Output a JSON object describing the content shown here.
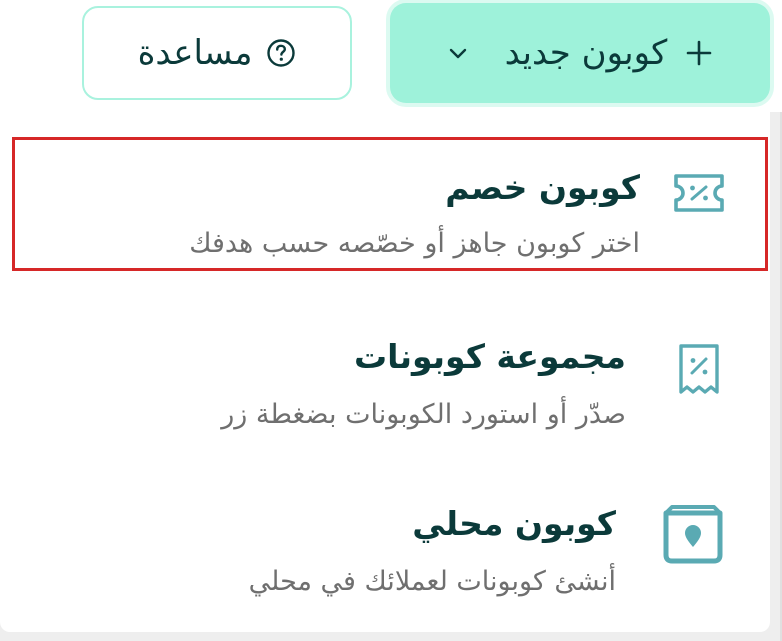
{
  "toolbar": {
    "help_label": "مساعدة",
    "new_coupon_label": "كوبون جديد"
  },
  "menu": {
    "items": [
      {
        "title": "كوبون خصم",
        "description": "اختر كوبون جاهز أو خصّصه حسب هدفك",
        "icon": "ticket-percent-icon"
      },
      {
        "title": "مجموعة كوبونات",
        "description": "صدّر أو استورد الكوبونات بضغطة زر",
        "icon": "receipt-percent-icon"
      },
      {
        "title": "كوبون محلي",
        "description": "أنشئ كوبونات لعملائك في محلي",
        "icon": "location-card-icon"
      }
    ]
  },
  "colors": {
    "accent": "#9ef2da",
    "accent_border": "#a9f2de",
    "icon_teal": "#5aaab3",
    "text_dark": "#0b3a3a",
    "text_muted": "#6f6f6f",
    "highlight": "#d62828"
  }
}
